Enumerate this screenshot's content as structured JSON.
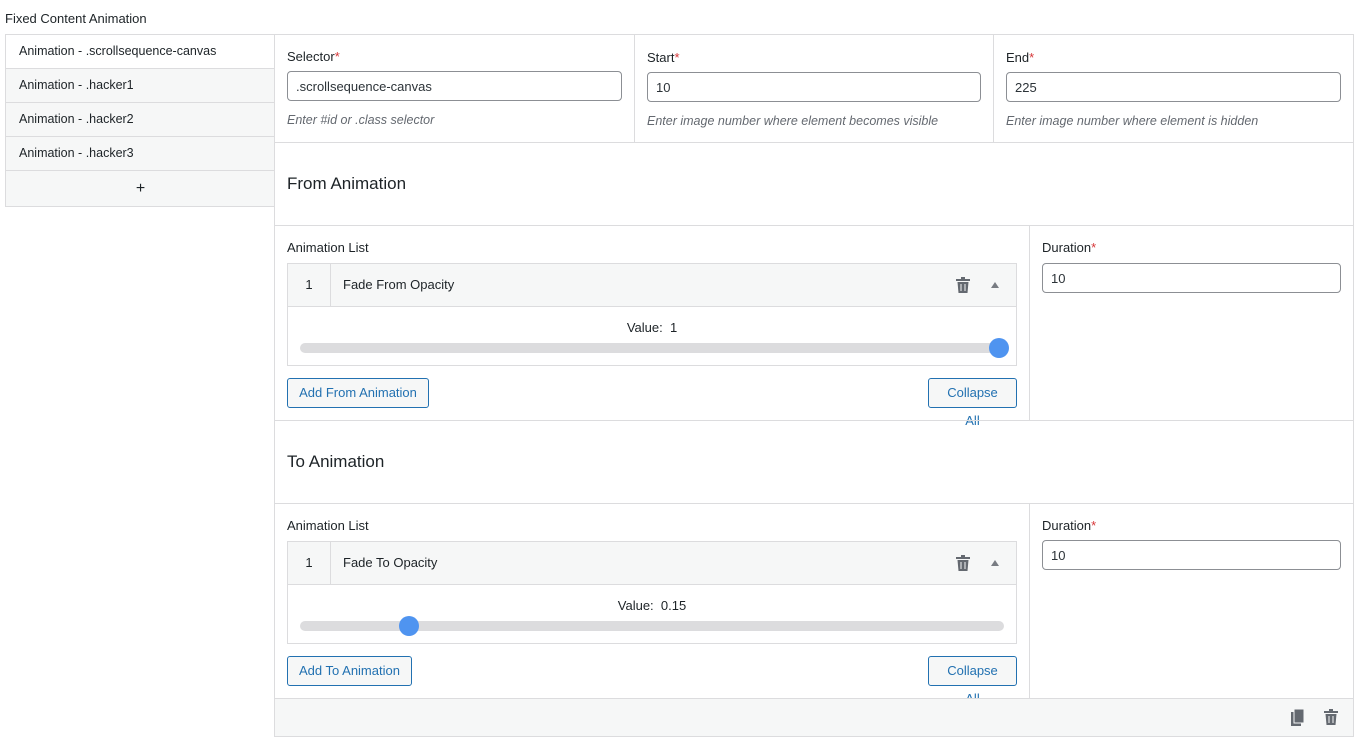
{
  "page": {
    "title": "Fixed Content Animation"
  },
  "tabs": [
    {
      "label": "Animation - .scrollsequence-canvas"
    },
    {
      "label": "Animation - .hacker1"
    },
    {
      "label": "Animation - .hacker2"
    },
    {
      "label": "Animation - .hacker3"
    }
  ],
  "add_tab_label": "+",
  "fields": {
    "selector": {
      "label": "Selector",
      "required": "*",
      "value": ".scrollsequence-canvas",
      "hint": "Enter #id or .class selector"
    },
    "start": {
      "label": "Start",
      "required": "*",
      "value": "10",
      "hint": "Enter image number where element becomes visible"
    },
    "end": {
      "label": "End",
      "required": "*",
      "value": "225",
      "hint": "Enter image number where element is hidden"
    }
  },
  "from_section": {
    "title": "From Animation",
    "list_label": "Animation List",
    "item": {
      "index": "1",
      "name": "Fade From Opacity",
      "value_label": "Value:",
      "value": "1",
      "slider_fraction": 1.0
    },
    "add_button": "Add From Animation",
    "collapse_button": "Collapse All",
    "duration_label": "Duration",
    "duration_required": "*",
    "duration_value": "10"
  },
  "to_section": {
    "title": "To Animation",
    "list_label": "Animation List",
    "item": {
      "index": "1",
      "name": "Fade To Opacity",
      "value_label": "Value:",
      "value": "0.15",
      "slider_fraction": 0.15
    },
    "add_button": "Add To Animation",
    "collapse_button": "Collapse All",
    "duration_label": "Duration",
    "duration_required": "*",
    "duration_value": "10"
  },
  "icons": {
    "trash": "trash-icon",
    "caret": "caret-up-icon",
    "copy": "copy-icon"
  },
  "colors": {
    "accent": "#2271b1",
    "slider": "#4f94f0",
    "required": "#d63638"
  }
}
